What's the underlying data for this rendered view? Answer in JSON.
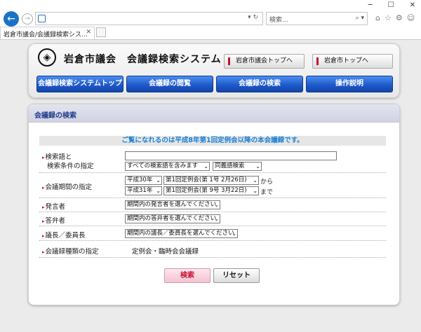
{
  "browser": {
    "window_controls": [
      "─",
      "☐",
      "✕"
    ],
    "back_glyph": "←",
    "forward_glyph": "→",
    "address_arrows": "▾ ↻",
    "search_placeholder": "検索...",
    "search_glyph": "⌕ ▾",
    "toolbar_icons": [
      "⌂",
      "☆",
      "⚙",
      "☺"
    ],
    "tab_title": "岩倉市議会/会議録検索シス...",
    "tab_close": "✕"
  },
  "header": {
    "logo_glyph": "◈",
    "site_title": "岩倉市議会　会議録検索システム",
    "link_council_top": "岩倉市議会トップへ",
    "link_city_top": "岩倉市トップへ"
  },
  "nav": {
    "items": [
      "会議録検索システムトップ",
      "会議録の閲覧",
      "会議録の検索",
      "操作説明"
    ]
  },
  "main": {
    "heading": "会議録の検索",
    "notice": "ご覧になれるのは平成8年第1回定例会以降の本会議録です。",
    "keyword": {
      "label_line1": "検索語と",
      "label_line2": "検索条件の指定",
      "input_value": "",
      "condition_select": "すべての検索語を含みます",
      "synonym_select": "同義語検索"
    },
    "period": {
      "label": "会議期間の指定",
      "from_year": "平成30年",
      "from_session": "第1回定例会(第 1号 2月26日)",
      "from_suffix": "から",
      "to_year": "平成31年",
      "to_session": "第1回定例会(第 9号 3月22日)",
      "to_suffix": "まで"
    },
    "speaker": {
      "label": "発言者",
      "select": "期間内の発言者を選んでください"
    },
    "responder": {
      "label": "答弁者",
      "select": "期間内の答弁者を選んでください"
    },
    "chair": {
      "label": "議長／委員長",
      "select": "期間内の議長／委員長を選んでください"
    },
    "record_type": {
      "label": "会議録種類の指定",
      "value": "定例会・臨時会会議録"
    },
    "search_button": "検索",
    "reset_button": "リセット"
  },
  "colors": {
    "nav_blue": "#1c56c8",
    "accent_red": "#c8102e",
    "notice_blue": "#1a7fd4",
    "heading_blue": "#1f3b8a"
  }
}
